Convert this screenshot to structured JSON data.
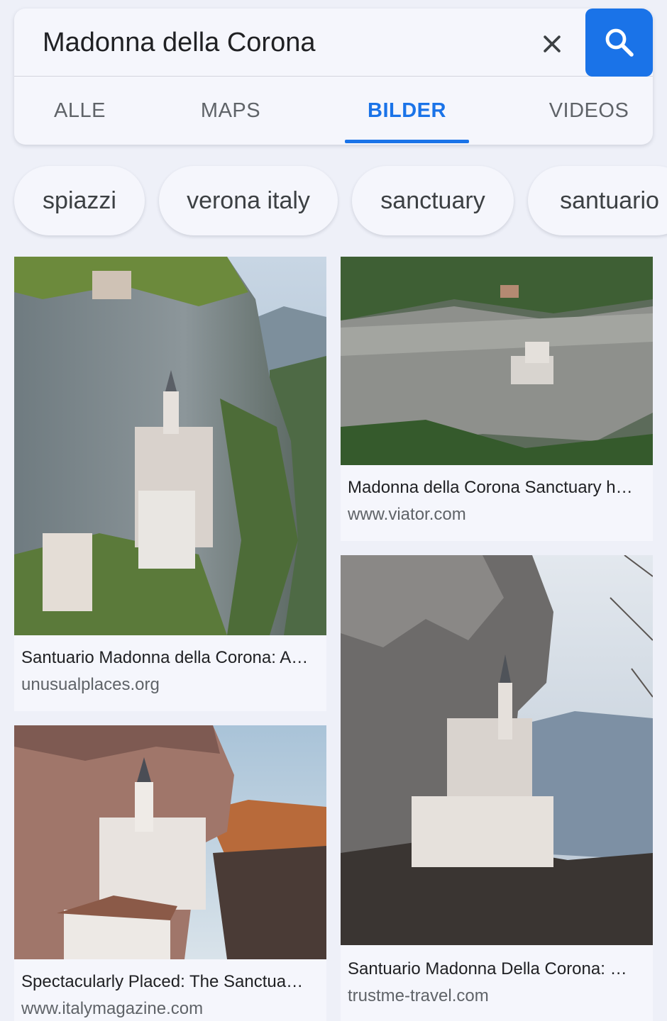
{
  "search": {
    "query": "Madonna della Corona",
    "clear_icon": "close-icon",
    "search_icon": "search-icon",
    "accent_color": "#1a73e8"
  },
  "tabs": [
    {
      "label": "ALLE",
      "active": false
    },
    {
      "label": "MAPS",
      "active": false
    },
    {
      "label": "BILDER",
      "active": true
    },
    {
      "label": "VIDEOS",
      "active": false
    }
  ],
  "chips": [
    "spiazzi",
    "verona italy",
    "sanctuary",
    "santuario"
  ],
  "results": [
    {
      "title": "Santuario Madonna della Corona: A…",
      "domain": "unusualplaces.org"
    },
    {
      "title": "Madonna della Corona Sanctuary h…",
      "domain": "www.viator.com"
    },
    {
      "title": "Spectacularly Placed: The Sanctua…",
      "domain": "www.italymagazine.com"
    },
    {
      "title": "Santuario Madonna Della Corona: …",
      "domain": "trustme-travel.com"
    }
  ]
}
